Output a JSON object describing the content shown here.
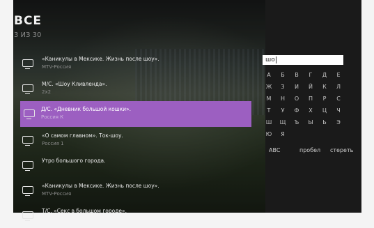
{
  "header": {
    "title": "ВСЕ",
    "count": "3 ИЗ 30"
  },
  "list": [
    {
      "name": "«Каникулы в Мексике. Жизнь после шоу».",
      "channel": "MTV-Россия"
    },
    {
      "name": "М/С. «Шоу Кливленда».",
      "channel": "2x2"
    },
    {
      "name": "Д/С. «Дневник большой кошки».",
      "channel": "Россия К"
    },
    {
      "name": "«О самом главном». Ток-шоу.",
      "channel": "Россия 1"
    },
    {
      "name": "Утро большого города.",
      "channel": ""
    },
    {
      "name": "«Каникулы в Мексике. Жизнь после шоу».",
      "channel": "MTV-Россия"
    },
    {
      "name": "Т/С. «Секс в большом городе».",
      "channel": ""
    }
  ],
  "search": {
    "value": "шо"
  },
  "keyboard": {
    "rows": [
      [
        "А",
        "Б",
        "В",
        "Г",
        "Д",
        "Е"
      ],
      [
        "Ж",
        "З",
        "И",
        "Й",
        "К",
        "Л"
      ],
      [
        "М",
        "Н",
        "О",
        "П",
        "Р",
        "С"
      ],
      [
        "Т",
        "У",
        "Ф",
        "Х",
        "Ц",
        "Ч"
      ],
      [
        "Ш",
        "Щ",
        "Ъ",
        "Ы",
        "Ь",
        "Э"
      ],
      [
        "Ю",
        "Я"
      ]
    ],
    "abc_label": "ABC",
    "space_label": "пробел",
    "erase_label": "стереть"
  },
  "colors": {
    "accent": "#9c5fc1"
  }
}
